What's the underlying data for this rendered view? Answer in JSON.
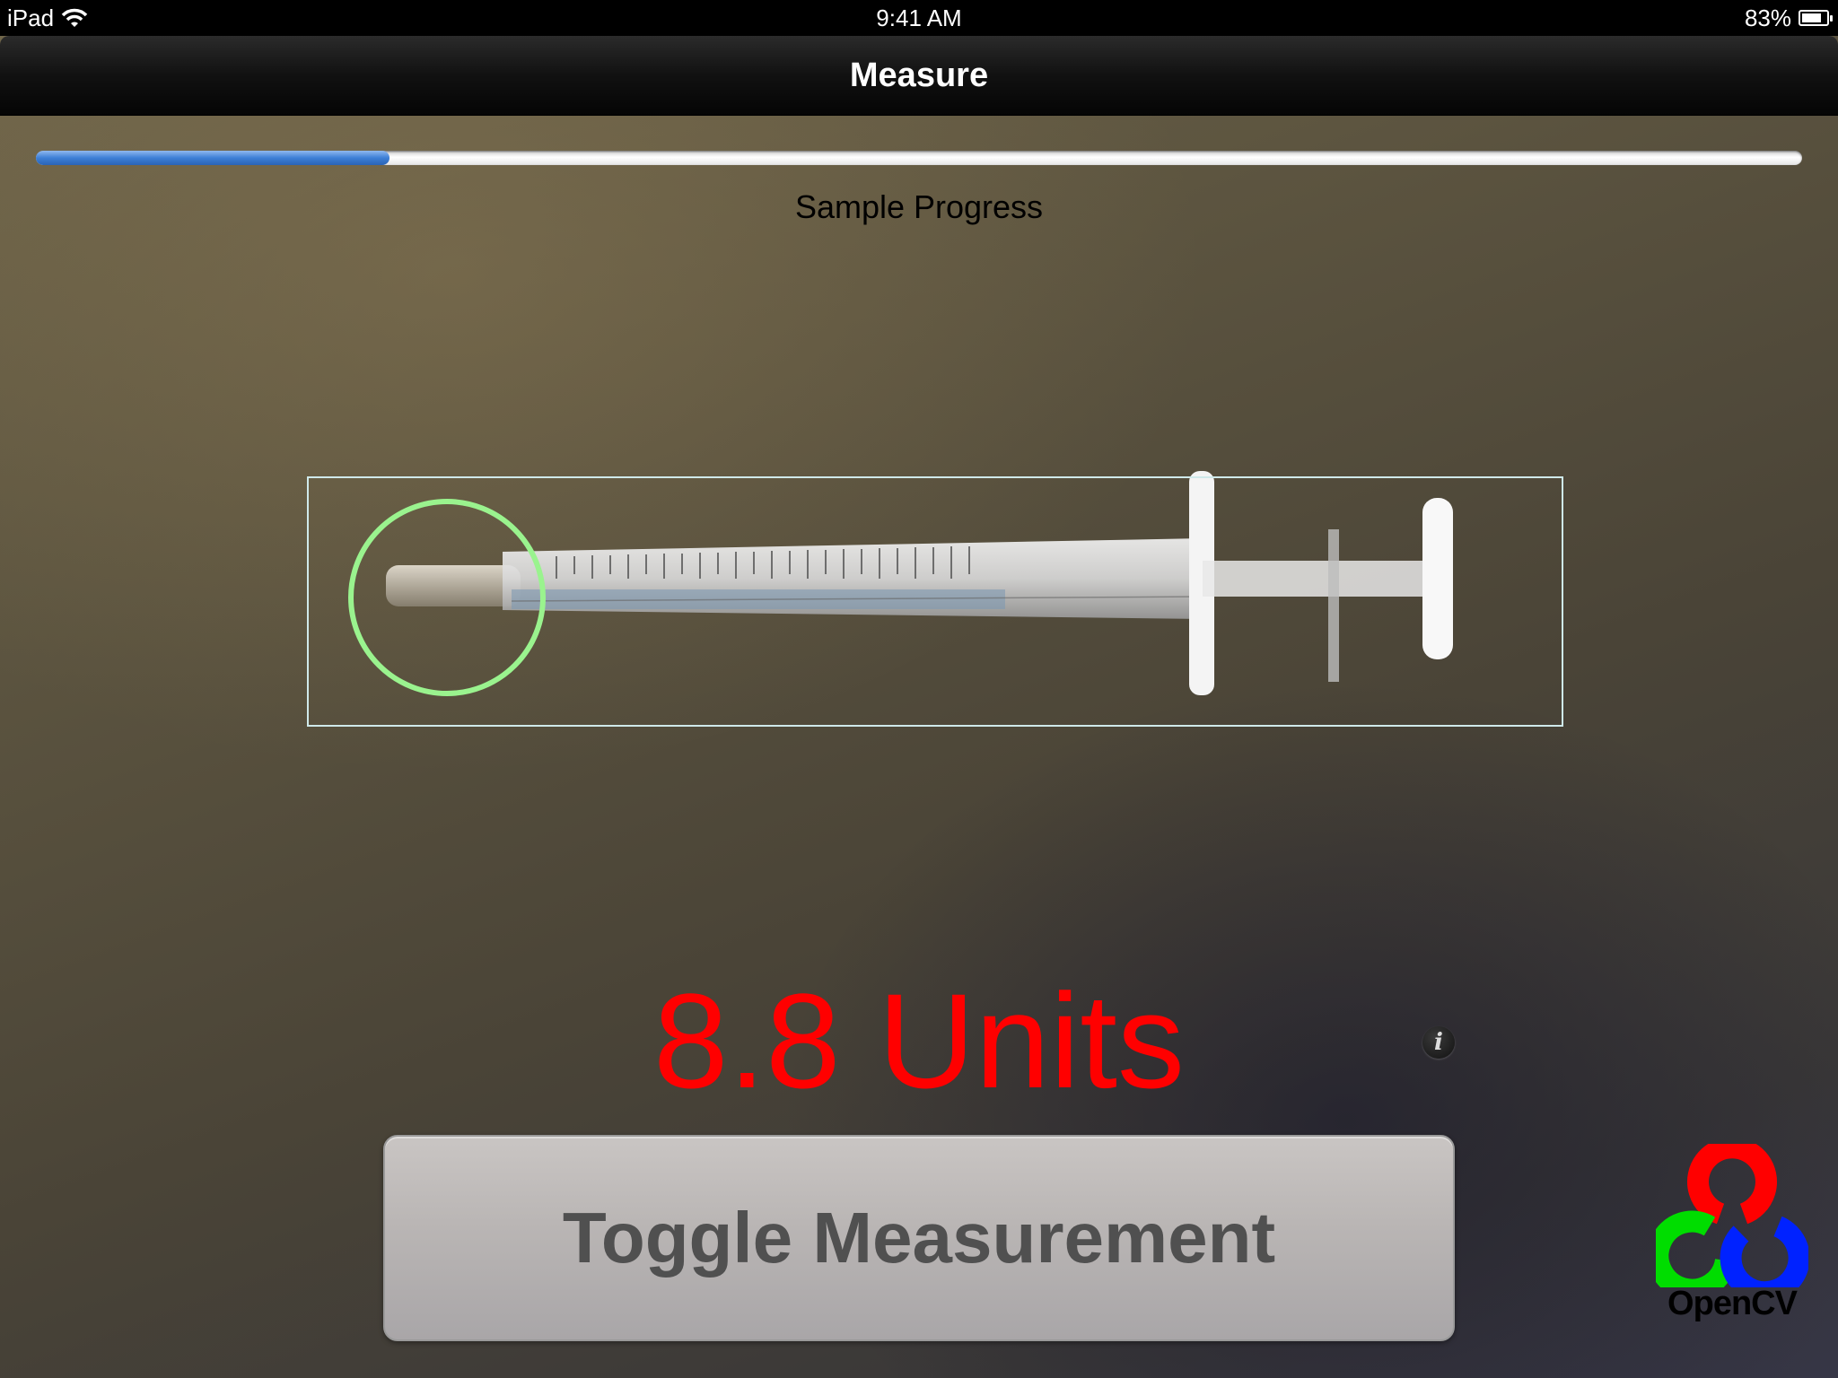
{
  "status_bar": {
    "device": "iPad",
    "time": "9:41 AM",
    "battery": "83%",
    "battery_level": 0.83
  },
  "navbar": {
    "title": "Measure"
  },
  "progress": {
    "label": "Sample Progress",
    "value": 0.2
  },
  "measurement": {
    "readout": "8.8 Units"
  },
  "toggle_button": {
    "label": "Toggle Measurement"
  },
  "logo": {
    "text": "OpenCV"
  },
  "colors": {
    "readout": "#ff0000",
    "tip_circle": "#9af38e",
    "progress_fill": "#3d7fd6"
  },
  "icons": [
    "wifi-icon",
    "battery-icon",
    "info-icon",
    "opencv-logo"
  ]
}
